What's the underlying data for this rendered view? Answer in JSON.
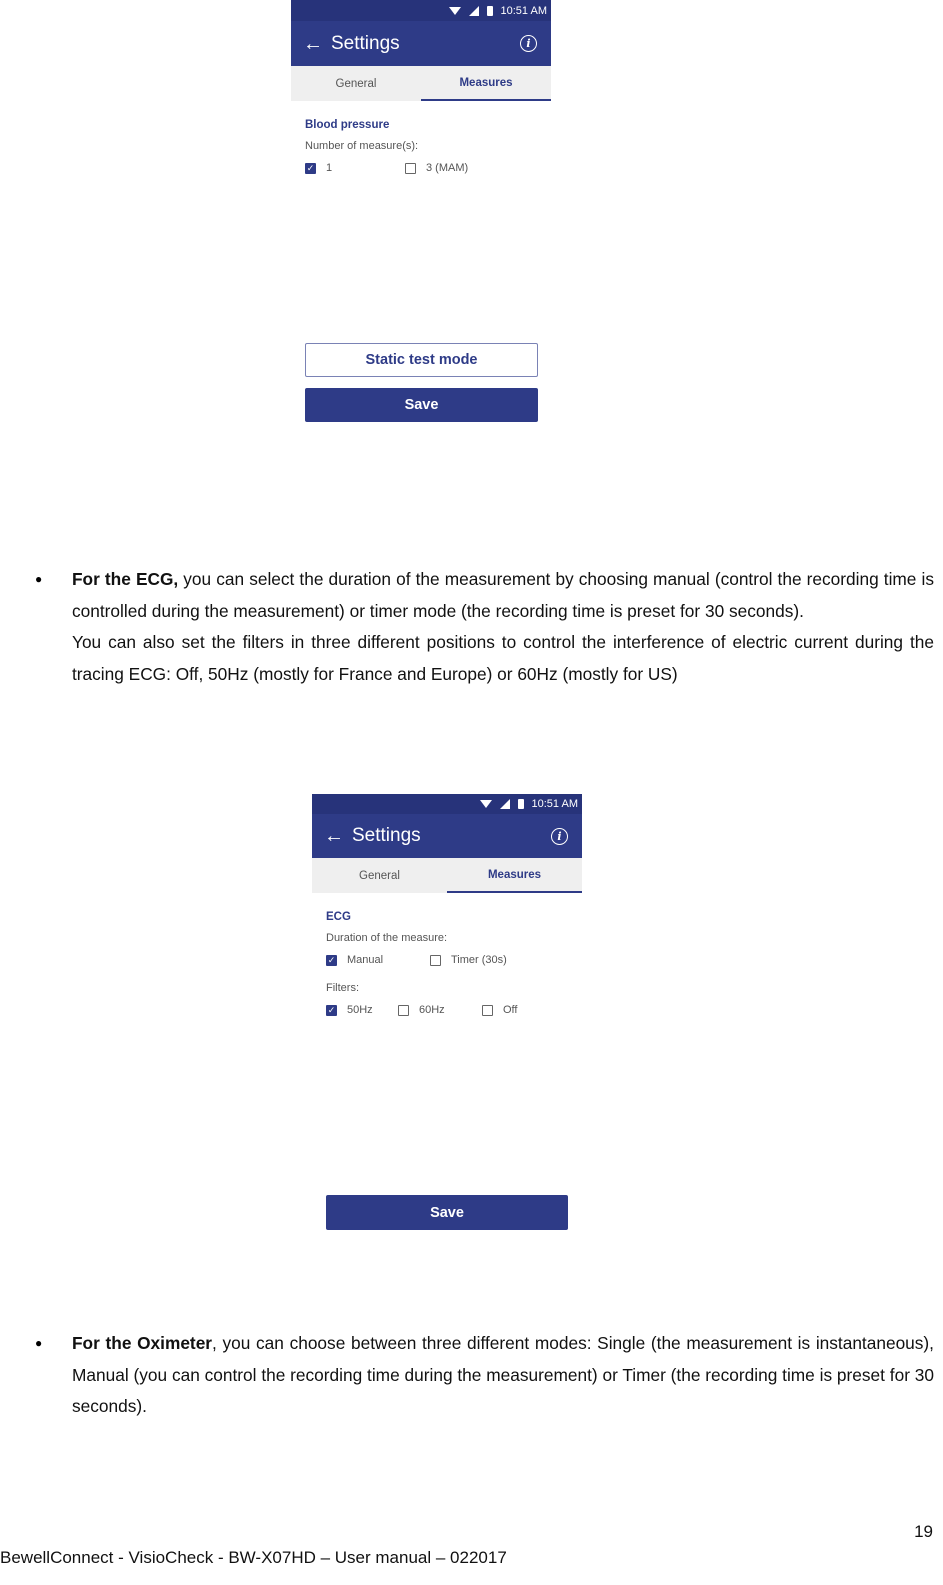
{
  "colors": {
    "statusbar": "#27337a",
    "appbar": "#2e3b87",
    "accent": "#2e3b87",
    "tab_bg": "#efefef"
  },
  "screen1": {
    "status_time": "10:51 AM",
    "status_icons": [
      "wifi-icon",
      "signal-icon",
      "battery-icon"
    ],
    "title": "Settings",
    "tabs": [
      {
        "label": "General",
        "active": false
      },
      {
        "label": "Measures",
        "active": true
      }
    ],
    "section_title": "Blood pressure",
    "field_label": "Number of measure(s):",
    "options": [
      {
        "label": "1",
        "checked": true
      },
      {
        "label": "3 (MAM)",
        "checked": false
      }
    ],
    "static_test_button": "Static test mode",
    "save_button": "Save"
  },
  "ecg_paragraph": {
    "bold_lead": "For the ECG,",
    "text": " you can select the duration of the measurement by choosing manual (control the recording time is controlled during the measurement) or timer mode (the recording time is preset for 30 seconds).",
    "text2": "You can also set the filters in three different positions to control the interference of electric current during the tracing ECG: Off, 50Hz (mostly for France and Europe) or 60Hz (mostly for US)"
  },
  "screen2": {
    "status_time": "10:51 AM",
    "status_icons": [
      "wifi-icon",
      "signal-icon",
      "battery-icon"
    ],
    "title": "Settings",
    "tabs": [
      {
        "label": "General",
        "active": false
      },
      {
        "label": "Measures",
        "active": true
      }
    ],
    "section_title": "ECG",
    "duration_label": "Duration of the measure:",
    "duration_options": [
      {
        "label": "Manual",
        "checked": true
      },
      {
        "label": "Timer (30s)",
        "checked": false
      }
    ],
    "filters_label": "Filters:",
    "filter_options": [
      {
        "label": "50Hz",
        "checked": true
      },
      {
        "label": "60Hz",
        "checked": false
      },
      {
        "label": "Off",
        "checked": false
      }
    ],
    "save_button": "Save"
  },
  "oximeter_paragraph": {
    "bold_lead": "For the Oximeter",
    "text": ", you can choose between three different modes: Single (the measurement is instantaneous), Manual (you can control the recording time during the measurement) or Timer (the recording time is preset for 30 seconds)."
  },
  "footer": {
    "page_number": "19",
    "document_title": "BewellConnect - VisioCheck - BW-X07HD – User manual – 022017"
  }
}
